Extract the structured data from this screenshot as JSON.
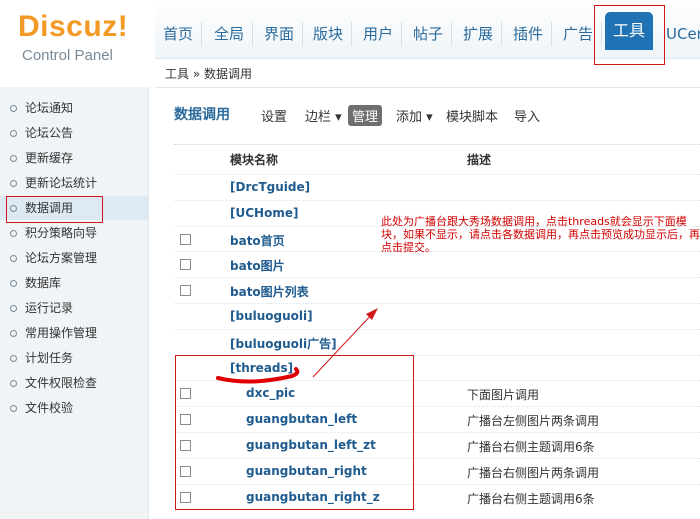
{
  "logo": {
    "title": "Discuz!",
    "subtitle": "Control Panel"
  },
  "topnav": {
    "tabs": [
      "首页",
      "全局",
      "界面",
      "版块",
      "用户",
      "帖子",
      "扩展",
      "插件",
      "广告",
      "工具",
      "UCenter"
    ],
    "active": "工具"
  },
  "breadcrumb": "工具 » 数据调用",
  "sidebar": {
    "items": [
      "论坛通知",
      "论坛公告",
      "更新缓存",
      "更新论坛统计",
      "数据调用",
      "积分策略向导",
      "论坛方案管理",
      "数据库",
      "运行记录",
      "常用操作管理",
      "计划任务",
      "文件权限检查",
      "文件校验"
    ],
    "active": "数据调用"
  },
  "main": {
    "title": "数据调用",
    "subtabs": [
      "设置",
      "边栏 ▾",
      "管理",
      "添加 ▾",
      "模块脚本",
      "导入"
    ],
    "active_subtab": "管理",
    "columns": {
      "name": "模块名称",
      "desc": "描述"
    },
    "rows": [
      {
        "name": "[DrcTguide]",
        "checkbox": false,
        "indent": false,
        "desc": ""
      },
      {
        "name": "[UCHome]",
        "checkbox": false,
        "indent": false,
        "desc": ""
      },
      {
        "name": "bato首页",
        "checkbox": true,
        "indent": false,
        "desc": ""
      },
      {
        "name": "bato图片",
        "checkbox": true,
        "indent": false,
        "desc": ""
      },
      {
        "name": "bato图片列表",
        "checkbox": true,
        "indent": false,
        "desc": ""
      },
      {
        "name": "[buluoguoli]",
        "checkbox": false,
        "indent": false,
        "desc": ""
      },
      {
        "name": "[buluoguoli广告]",
        "checkbox": false,
        "indent": false,
        "desc": ""
      },
      {
        "name": "[threads]",
        "checkbox": false,
        "indent": false,
        "desc": ""
      },
      {
        "name": "dxc_pic",
        "checkbox": true,
        "indent": true,
        "desc": "下面图片调用"
      },
      {
        "name": "guangbutan_left",
        "checkbox": true,
        "indent": true,
        "desc": "广播台左侧图片两条调用"
      },
      {
        "name": "guangbutan_left_zt",
        "checkbox": true,
        "indent": true,
        "desc": "广播台右侧主题调用6条"
      },
      {
        "name": "guangbutan_right",
        "checkbox": true,
        "indent": true,
        "desc": "广播台右侧图片两条调用"
      },
      {
        "name": "guangbutan_right_z",
        "checkbox": true,
        "indent": true,
        "desc": "广播台右侧主题调用6条"
      }
    ]
  },
  "annotation": "此处为广播台跟大秀场数据调用，点击threads就会显示下面模块，如果不显示，请点击各数据调用，再点击预览成功显示后，再点击提交。"
}
